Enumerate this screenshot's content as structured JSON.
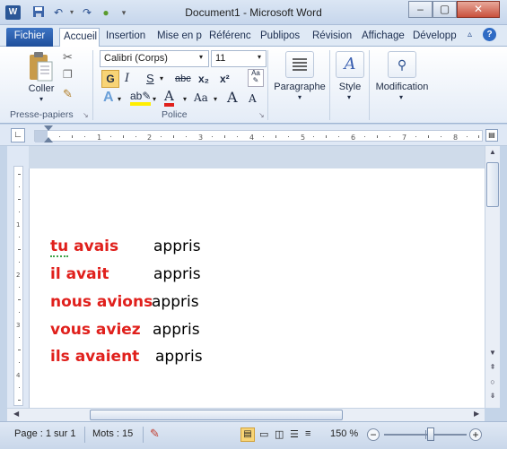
{
  "window": {
    "title": "Document1 - Microsoft Word",
    "app_icon": "W",
    "minimize": "–",
    "maximize": "▢",
    "close": "✕"
  },
  "quick_access": [
    "save-icon",
    "undo-icon",
    "redo-icon",
    "refresh-icon"
  ],
  "tabs": {
    "file": "Fichier",
    "items": [
      "Accueil",
      "Insertion",
      "Mise en p",
      "Référenc",
      "Publipos",
      "Révision",
      "Affichage",
      "Développ"
    ],
    "active": "Accueil"
  },
  "ribbon": {
    "clipboard": {
      "paste": "Coller",
      "label": "Presse-papiers"
    },
    "font": {
      "family": "Calibri (Corps)",
      "size": "11",
      "label": "Police",
      "bold": "G",
      "italic": "I",
      "underline": "S",
      "strike": "abc",
      "subscript": "x₂",
      "superscript": "x²",
      "grow": "A",
      "shrink": "A",
      "case": "Aa"
    },
    "paragraph": {
      "label": "Paragraphe"
    },
    "style": {
      "label": "Style"
    },
    "editing": {
      "label": "Modification"
    }
  },
  "document": {
    "lines": [
      {
        "subject": "tu avais",
        "verb": "appris"
      },
      {
        "subject": "il avait",
        "verb": "appris"
      },
      {
        "subject": "nous avions",
        "verb": "appris"
      },
      {
        "subject": "vous aviez",
        "verb": "appris"
      },
      {
        "subject": "ils avaient",
        "verb": "appris"
      }
    ]
  },
  "status": {
    "page": "Page : 1 sur 1",
    "words": "Mots : 15",
    "zoom": "150 %",
    "zoom_level": 150
  },
  "colors": {
    "subject": "#e0201c",
    "file_tab": "#2b5797"
  }
}
